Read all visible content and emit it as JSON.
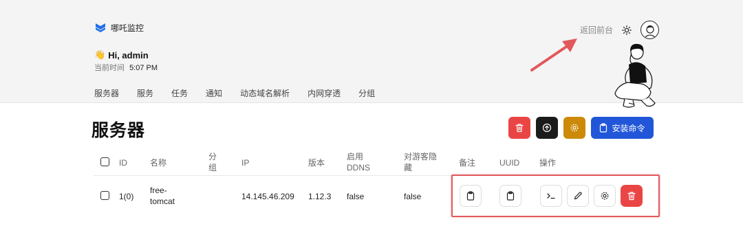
{
  "brand": {
    "name": "哪吒监控"
  },
  "header": {
    "back_link": "返回前台",
    "greeting": "Hi, admin",
    "wave_emoji": "👋",
    "time_label": "当前时间",
    "time_value": "5:07 PM"
  },
  "nav": {
    "items": [
      {
        "label": "服务器"
      },
      {
        "label": "服务"
      },
      {
        "label": "任务"
      },
      {
        "label": "通知"
      },
      {
        "label": "动态域名解析"
      },
      {
        "label": "内网穿透"
      },
      {
        "label": "分组"
      }
    ]
  },
  "page": {
    "title": "服务器"
  },
  "toolbar": {
    "delete_icon": "trash-icon",
    "upload_icon": "upload-circle-icon",
    "settings_icon": "gear-icon",
    "install_label": "安装命令",
    "install_icon": "clipboard-icon"
  },
  "table": {
    "headers": {
      "id": "ID",
      "name": "名称",
      "group_l1": "分",
      "group_l2": "组",
      "ip": "IP",
      "version": "版本",
      "ddns_l1": "启用",
      "ddns_l2": "DDNS",
      "hide_l1": "对游客隐",
      "hide_l2": "藏",
      "note": "备注",
      "uuid": "UUID",
      "actions": "操作"
    },
    "rows": [
      {
        "id": "1(0)",
        "name_l1": "free-",
        "name_l2": "tomcat",
        "group": "",
        "ip": "14.145.46.209",
        "version": "1.12.3",
        "ddns": "false",
        "hide": "false",
        "note_icon": "clipboard-icon",
        "uuid_icon": "clipboard-icon",
        "action_icons": [
          "terminal-icon",
          "pencil-icon",
          "gear-icon",
          "trash-icon"
        ]
      }
    ]
  },
  "colors": {
    "red": "#ea4545",
    "black": "#1b1b1b",
    "amber": "#cc8a08",
    "blue": "#2156d9",
    "annotation": "#e2585b"
  }
}
